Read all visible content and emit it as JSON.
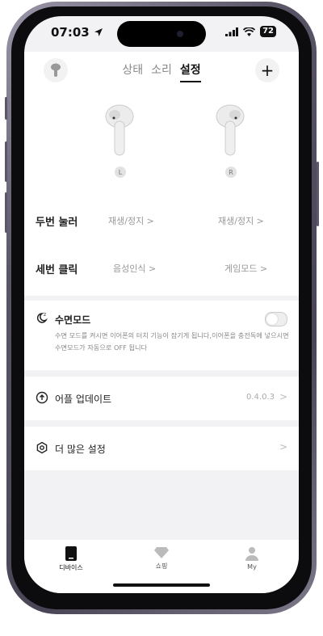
{
  "status": {
    "time": "07:03",
    "battery": "72"
  },
  "tabs": [
    "상태",
    "소리",
    "설정"
  ],
  "active_tab": "설정",
  "earbuds": {
    "left": "L",
    "right": "R"
  },
  "gestures": [
    {
      "label": "두번 눌러",
      "left": "재생/정지 >",
      "right": "재생/정지 >"
    },
    {
      "label": "세번 클릭",
      "left": "음성인식 >",
      "right": "게임모드 >"
    }
  ],
  "sleep_mode": {
    "label": "수면모드",
    "enabled": false,
    "description": "수면 모드를 켜시면 이어폰의 터치 기능이 잠기게 됩니다,이어폰을 충전독에 넣으시면 수면모드가 자동으로 OFF 됩니다"
  },
  "app_update": {
    "label": "어플 업데이트",
    "version": "0.4.0.3"
  },
  "more_settings": {
    "label": "더 많은 설정"
  },
  "bottom_nav": [
    {
      "label": "디바이스",
      "icon": "device-icon"
    },
    {
      "label": "쇼핑",
      "icon": "shopping-icon"
    },
    {
      "label": "My",
      "icon": "person-icon"
    }
  ]
}
